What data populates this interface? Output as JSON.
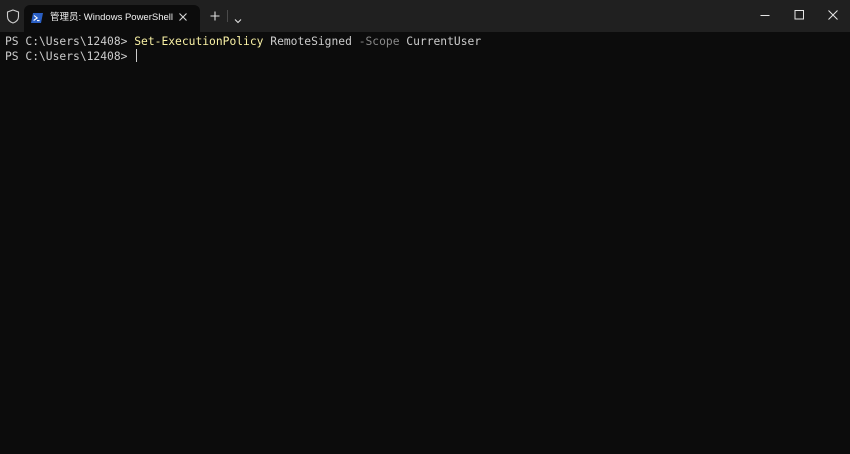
{
  "window": {
    "tab_title": "管理员: Windows PowerShell",
    "tab_icon": "powershell-icon",
    "admin_icon": "shield-icon",
    "new_tab_icon": "plus-icon",
    "dropdown_icon": "chevron-down-icon",
    "controls": [
      "minimize-icon",
      "maximize-icon",
      "close-icon"
    ]
  },
  "terminal": {
    "lines": [
      {
        "prompt": "PS C:\\Users\\12408> ",
        "cmdlet": "Set-ExecutionPolicy",
        "arg1": " RemoteSigned ",
        "param": "-Scope",
        "arg2": " CurrentUser"
      },
      {
        "prompt": "PS C:\\Users\\12408> "
      }
    ]
  },
  "colors": {
    "background": "#0c0c0c",
    "titlebar": "#202020",
    "foreground": "#cccccc",
    "cmdlet": "#f9f1a5",
    "parameter": "#8a8a8a"
  }
}
